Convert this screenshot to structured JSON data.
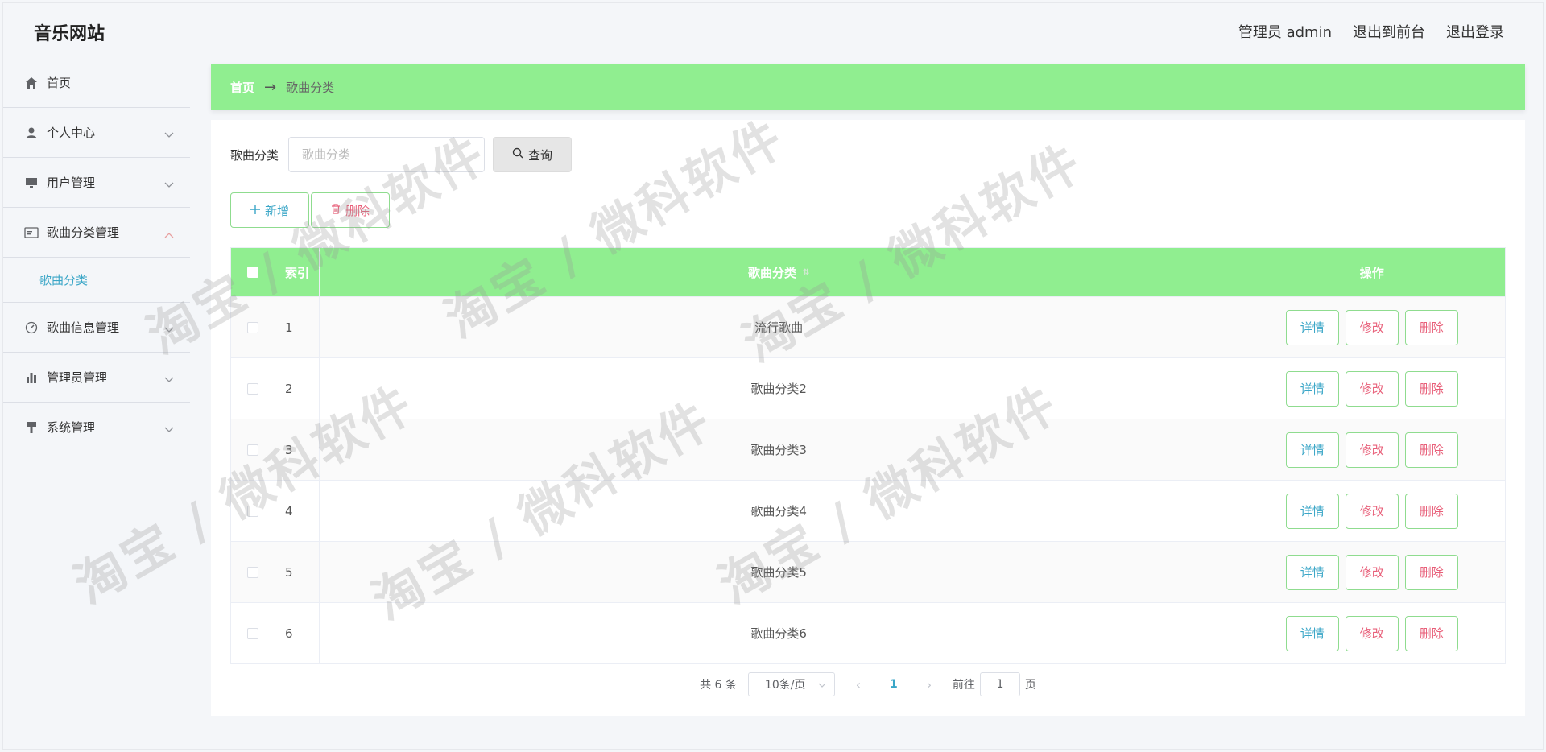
{
  "header": {
    "brand": "音乐网站",
    "admin": "管理员 admin",
    "to_front": "退出到前台",
    "logout": "退出登录"
  },
  "sidebar": {
    "items": [
      {
        "label": "首页",
        "icon": "home-icon"
      },
      {
        "label": "个人中心",
        "icon": "user-icon"
      },
      {
        "label": "用户管理",
        "icon": "monitor-icon"
      },
      {
        "label": "歌曲分类管理",
        "icon": "card-icon",
        "expanded": true
      },
      {
        "label": "歌曲信息管理",
        "icon": "gauge-icon"
      },
      {
        "label": "管理员管理",
        "icon": "bar-chart-icon"
      },
      {
        "label": "系统管理",
        "icon": "brush-icon"
      }
    ],
    "submenu": {
      "label": "歌曲分类"
    }
  },
  "breadcrumb": {
    "home": "首页",
    "arrow": "→",
    "current": "歌曲分类"
  },
  "search": {
    "label": "歌曲分类",
    "placeholder": "歌曲分类",
    "button": "查询"
  },
  "actions": {
    "add": "新增",
    "delete": "删除"
  },
  "table": {
    "headers": {
      "index": "索引",
      "name": "歌曲分类",
      "ops": "操作"
    },
    "rows": [
      {
        "index": "1",
        "name": "流行歌曲"
      },
      {
        "index": "2",
        "name": "歌曲分类2"
      },
      {
        "index": "3",
        "name": "歌曲分类3"
      },
      {
        "index": "4",
        "name": "歌曲分类4"
      },
      {
        "index": "5",
        "name": "歌曲分类5"
      },
      {
        "index": "6",
        "name": "歌曲分类6"
      }
    ],
    "row_buttons": {
      "detail": "详情",
      "edit": "修改",
      "delete": "删除"
    }
  },
  "pagination": {
    "total": "共 6 条",
    "page_size": "10条/页",
    "current_page": "1",
    "goto_label": "前往",
    "goto_value": "1",
    "page_suffix": "页"
  },
  "watermark": "淘宝 / 微科软件",
  "colors": {
    "accent_green": "#90ee90",
    "link_blue": "#3aa6c7",
    "danger_pink": "#e85f79"
  }
}
